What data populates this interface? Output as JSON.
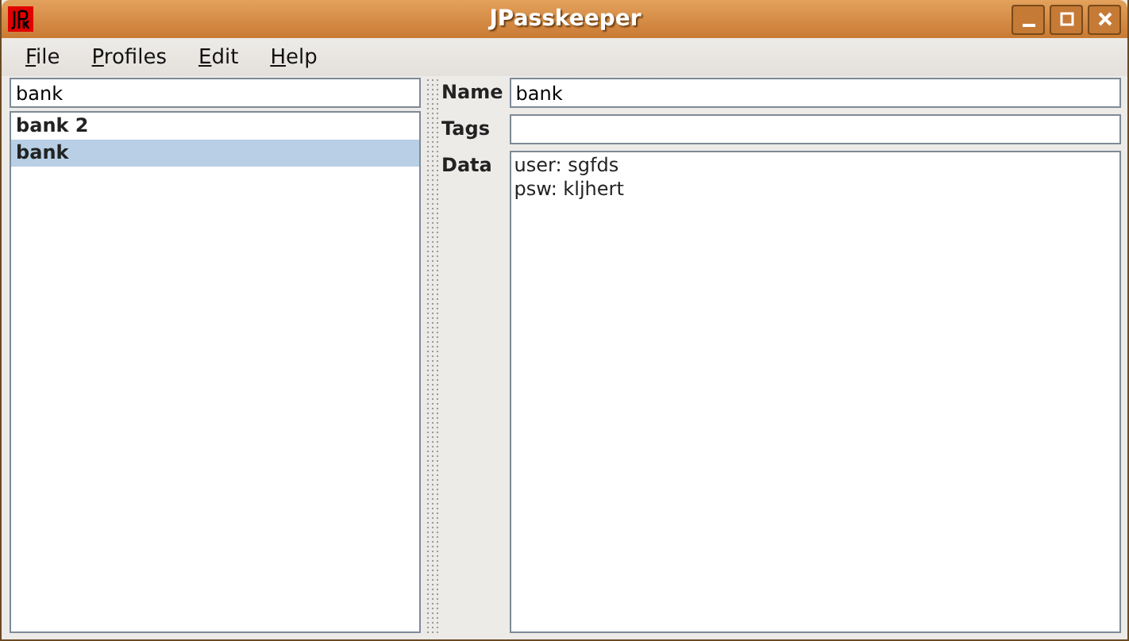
{
  "window": {
    "title": "JPasskeeper"
  },
  "menu": [
    {
      "label": "File"
    },
    {
      "label": "Profiles"
    },
    {
      "label": "Edit"
    },
    {
      "label": "Help"
    }
  ],
  "search": {
    "value": "bank"
  },
  "entries": [
    {
      "label": "bank 2",
      "selected": false
    },
    {
      "label": "bank",
      "selected": true
    }
  ],
  "form": {
    "name_label": "Name",
    "name_value": "bank",
    "tags_label": "Tags",
    "data_label": "Data",
    "data_lines": [
      "user: sgfds",
      "psw: kljhert"
    ]
  }
}
